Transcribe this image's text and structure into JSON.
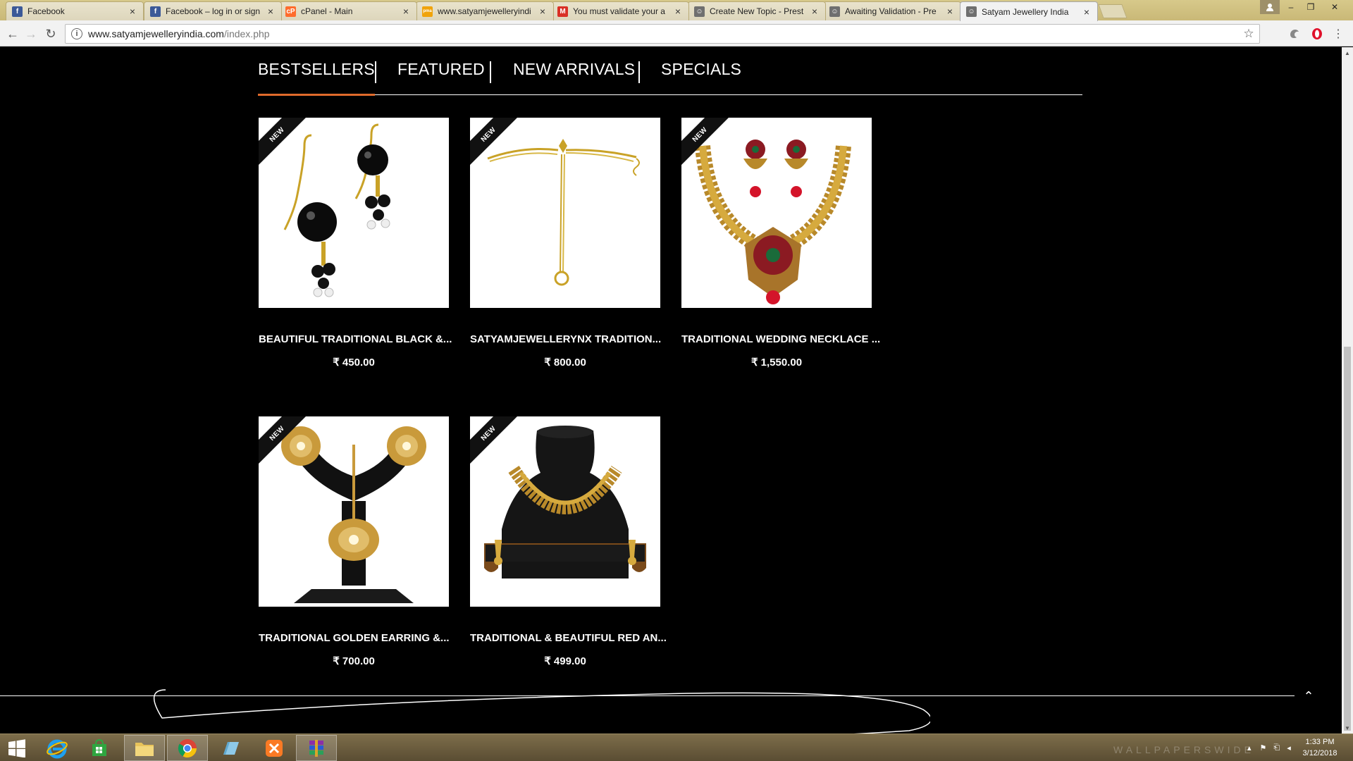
{
  "browser": {
    "tabs": [
      {
        "title": "Facebook",
        "icon": "facebook-icon",
        "color": "#3b5998",
        "glyph": "f",
        "active": false
      },
      {
        "title": "Facebook – log in or sign",
        "icon": "facebook-icon",
        "color": "#3b5998",
        "glyph": "f",
        "active": false
      },
      {
        "title": "cPanel - Main",
        "icon": "cpanel-icon",
        "color": "#ff6c2c",
        "glyph": "cP",
        "active": false
      },
      {
        "title": "www.satyamjewelleryindi",
        "icon": "phpmyadmin-icon",
        "color": "#f0a30a",
        "glyph": "pma",
        "active": false
      },
      {
        "title": "You must validate your a",
        "icon": "gmail-icon",
        "color": "#d93025",
        "glyph": "M",
        "active": false
      },
      {
        "title": "Create New Topic - Prest",
        "icon": "prestashop-icon",
        "color": "#6f6f6f",
        "glyph": "☺",
        "active": false
      },
      {
        "title": "Awaiting Validation - Pre",
        "icon": "prestashop-icon",
        "color": "#6f6f6f",
        "glyph": "☺",
        "active": false
      },
      {
        "title": "Satyam Jewellery India",
        "icon": "site-icon",
        "color": "#6f6f6f",
        "glyph": "☺",
        "active": true
      }
    ],
    "address": {
      "domain": "www.satyamjewelleryindia.com",
      "path": "/index.php"
    }
  },
  "page": {
    "tabs": [
      {
        "label": "BESTSELLERS",
        "active": true
      },
      {
        "label": "FEATURED",
        "active": false
      },
      {
        "label": "NEW ARRIVALS",
        "active": false
      },
      {
        "label": "SPECIALS",
        "active": false
      }
    ],
    "products": [
      {
        "name": "BEAUTIFUL TRADITIONAL BLACK &...",
        "price": "₹ 450.00",
        "badge": "NEW",
        "art": "black-earrings"
      },
      {
        "name": "SATYAMJEWELLERYNX TRADITION...",
        "price": "₹ 800.00",
        "badge": "NEW",
        "art": "hand-chain"
      },
      {
        "name": "TRADITIONAL WEDDING NECKLACE ...",
        "price": "₹ 1,550.00",
        "badge": "NEW",
        "art": "ruby-necklace"
      },
      {
        "name": "TRADITIONAL GOLDEN EARRING &...",
        "price": "₹ 700.00",
        "badge": "NEW",
        "art": "golden-earring-stand"
      },
      {
        "name": "TRADITIONAL & BEAUTIFUL RED AN...",
        "price": "₹ 499.00",
        "badge": "NEW",
        "art": "bust-necklace"
      }
    ],
    "accent": "#e06a2b"
  },
  "taskbar": {
    "clock_time": "1:33 PM",
    "clock_date": "3/12/2018",
    "watermark": "WALLPAPERSWIDE"
  }
}
